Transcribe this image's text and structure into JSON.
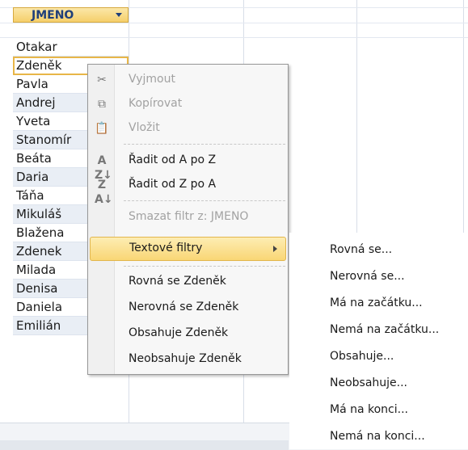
{
  "table": {
    "column_header": "JMENO",
    "rows": [
      "Otakar",
      "Zdeněk",
      "Pavla",
      "Andrej",
      "Yveta",
      "Stanomír",
      "Beáta",
      "Daria",
      "Táňa",
      "Mikuláš",
      "Blažena",
      "Zdenek",
      "Milada",
      "Denisa",
      "Daniela",
      "Emilián"
    ]
  },
  "context_menu": {
    "cut": "Vyjmout",
    "copy": "Kopírovat",
    "paste": "Vložit",
    "sort_asc": "Řadit od A po Z",
    "sort_desc": "Řadit od Z po A",
    "clear_filter": "Smazat filtr z: JMENO",
    "text_filters": "Textové filtry",
    "equals_value": "Rovná se Zdeněk",
    "not_equals_value": "Nerovná se Zdeněk",
    "contains_value": "Obsahuje Zdeněk",
    "not_contains_value": "Neobsahuje Zdeněk"
  },
  "submenu": {
    "items": [
      "Rovná se...",
      "Nerovná se...",
      "Má na začátku...",
      "Nemá na začátku...",
      "Obsahuje...",
      "Neobsahuje...",
      "Má na konci...",
      "Nemá na konci..."
    ]
  },
  "icons": {
    "cut": "scissors-icon",
    "copy": "copy-icon",
    "paste": "paste-icon",
    "sort_asc": "sort-az-icon",
    "sort_desc": "sort-za-icon"
  },
  "colors": {
    "header_fill": "#f5cf6b",
    "highlight": "#f9d675",
    "alt_row": "#e9eef5"
  }
}
